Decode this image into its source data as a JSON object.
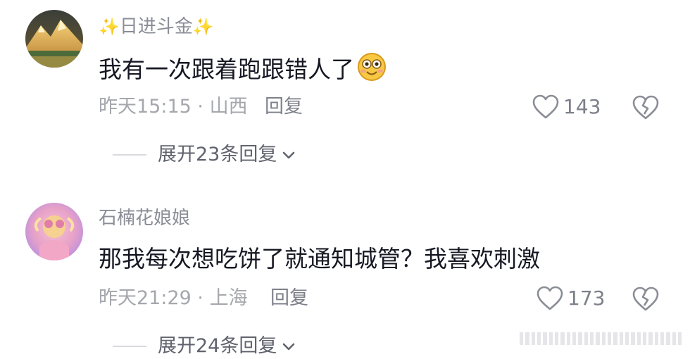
{
  "comments": [
    {
      "username_prefix": "✨",
      "username": "日进斗金",
      "username_suffix": "✨",
      "text": "我有一次跟着跑跟错人了",
      "emoji": "smiling-face-emoji",
      "time": "昨天15:15",
      "separator": "·",
      "location": "山西",
      "reply_label": "回复",
      "like_count": "143",
      "expand_label": "展开23条回复"
    },
    {
      "username": "石楠花娘娘",
      "text": "那我每次想吃饼了就通知城管？我喜欢刺激",
      "time": "昨天21:29",
      "separator": "·",
      "location": "上海",
      "reply_label": "回复",
      "like_count": "173",
      "expand_label": "展开24条回复"
    }
  ],
  "icons": {
    "like": "heart-outline-icon",
    "dislike": "broken-heart-icon",
    "expand": "chevron-down-icon"
  },
  "colors": {
    "text": "#161823",
    "secondary": "#a5a7ad",
    "sparkle": "#f2c94c"
  }
}
